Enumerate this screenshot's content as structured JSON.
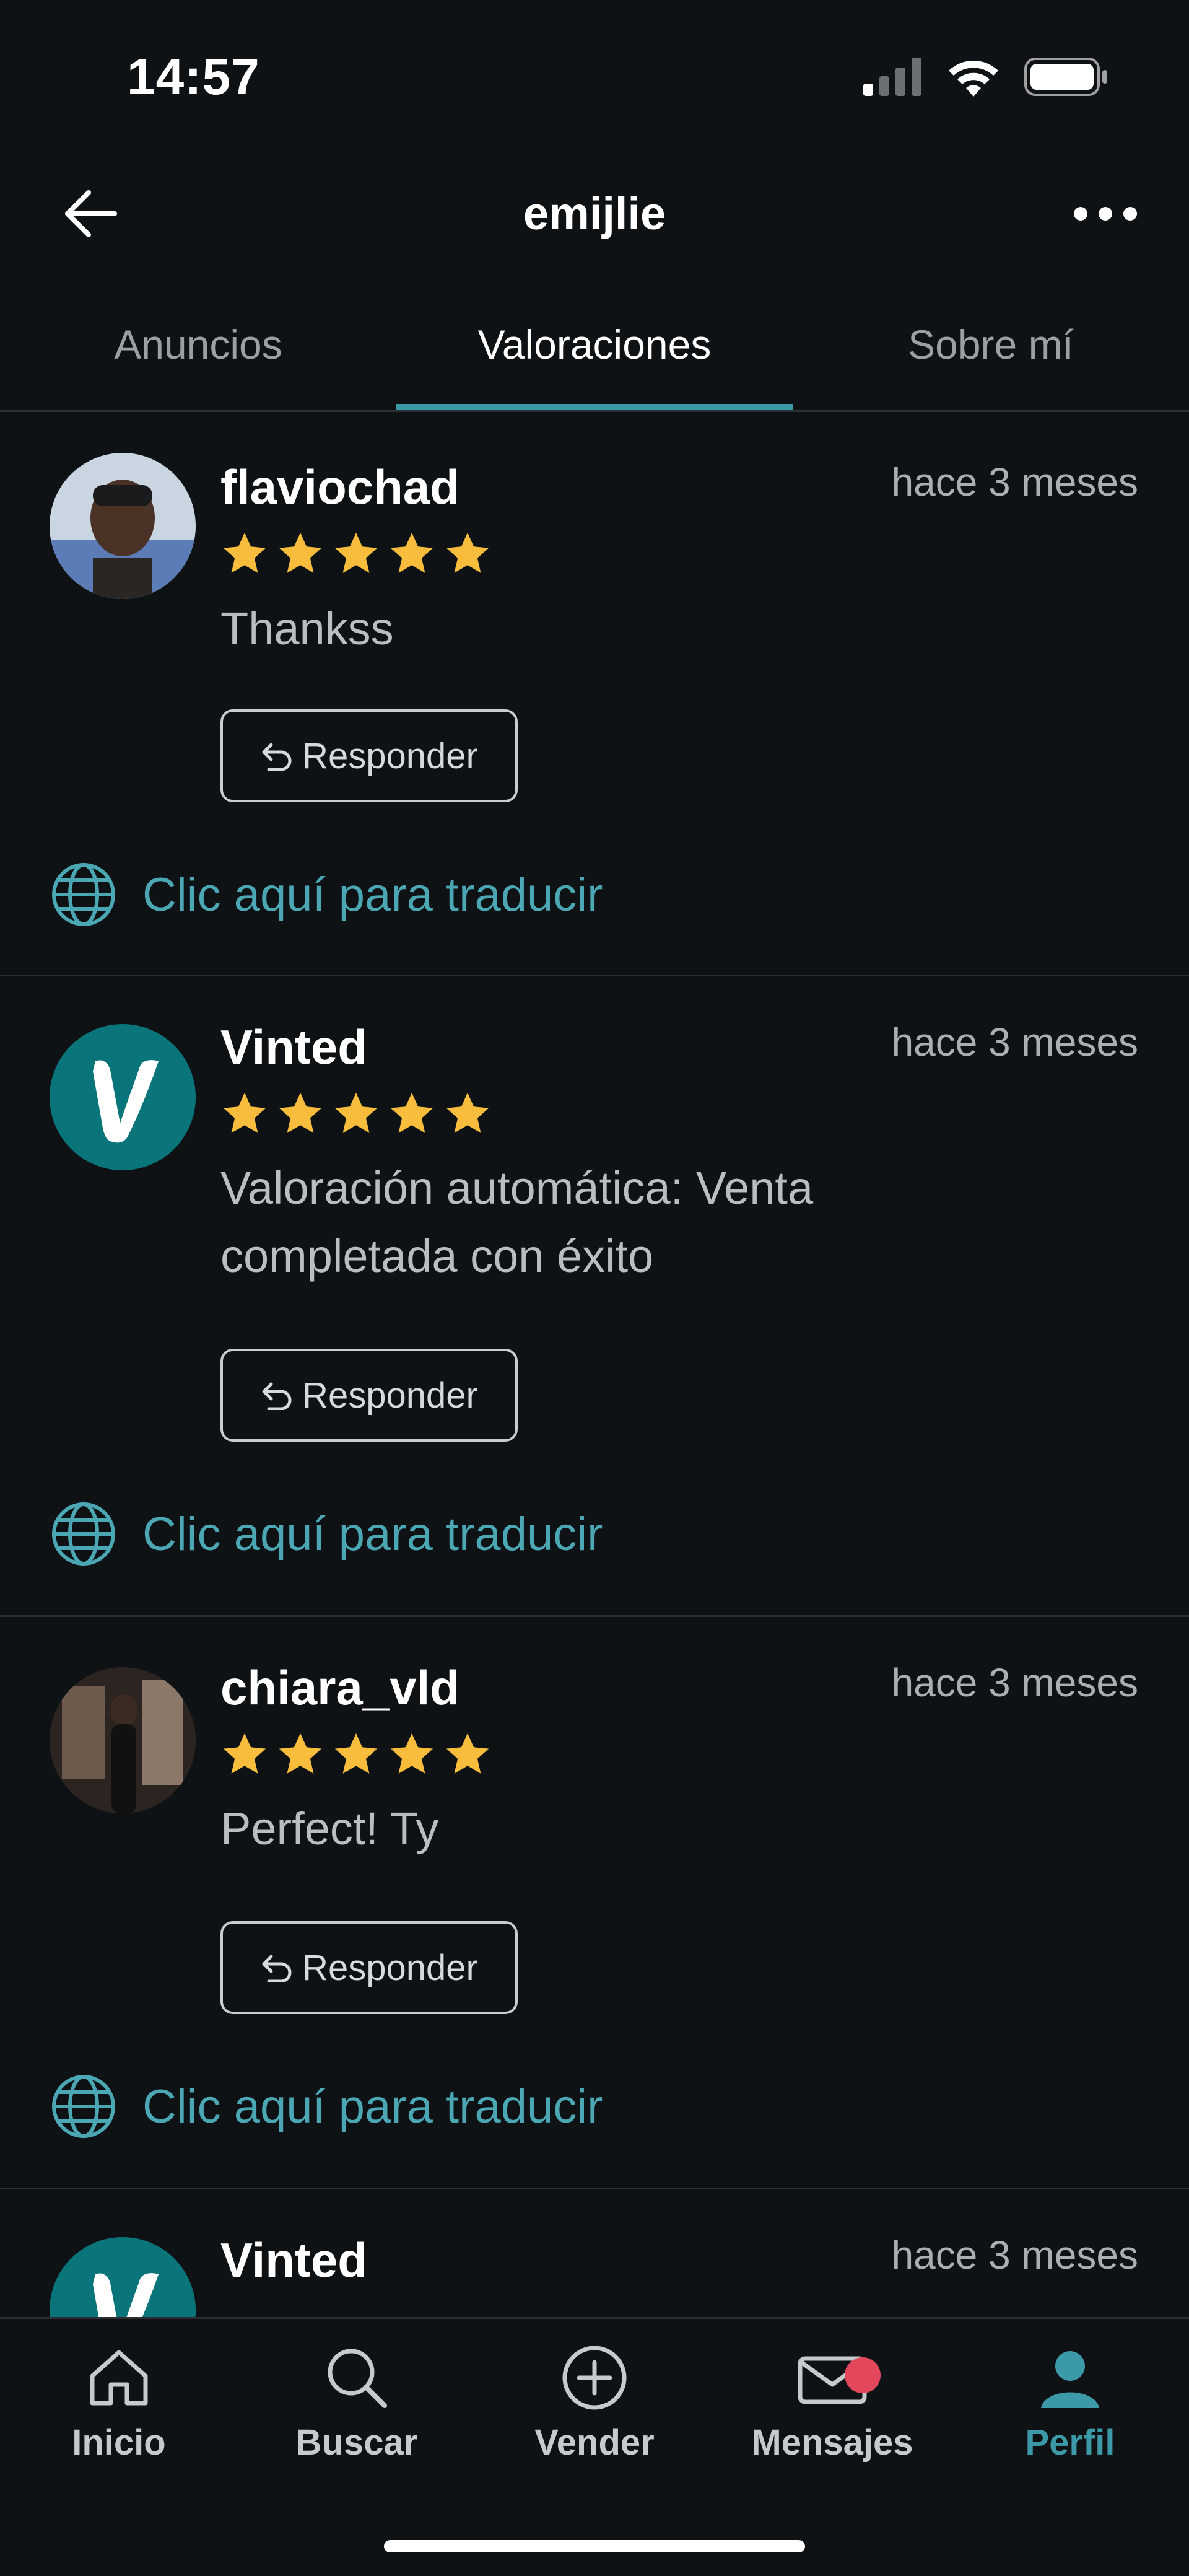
{
  "status_bar": {
    "time": "14:57"
  },
  "header": {
    "title": "emijlie"
  },
  "tabs": [
    {
      "label": "Anuncios",
      "active": false
    },
    {
      "label": "Valoraciones",
      "active": true
    },
    {
      "label": "Sobre mí",
      "active": false
    }
  ],
  "reviews": [
    {
      "username": "flaviochad",
      "date": "hace 3 meses",
      "rating": 5,
      "comment": "Thankss",
      "reply_label": "Responder",
      "translate_label": "Clic aquí para traducir"
    },
    {
      "username": "Vinted",
      "date": "hace 3 meses",
      "rating": 5,
      "comment": "Valoración automática: Venta completada con éxito",
      "reply_label": "Responder",
      "translate_label": "Clic aquí para traducir"
    },
    {
      "username": "chiara_vld",
      "date": "hace 3 meses",
      "rating": 5,
      "comment": "Perfect! Ty",
      "reply_label": "Responder",
      "translate_label": "Clic aquí para traducir"
    },
    {
      "username": "Vinted",
      "date": "hace 3 meses"
    }
  ],
  "bottom_nav": [
    {
      "label": "Inicio",
      "icon": "home-icon"
    },
    {
      "label": "Buscar",
      "icon": "search-icon"
    },
    {
      "label": "Vender",
      "icon": "plus-circle-icon"
    },
    {
      "label": "Mensajes",
      "icon": "mail-icon"
    },
    {
      "label": "Perfil",
      "icon": "profile-icon",
      "active": true
    }
  ],
  "colors": {
    "background": "#0f1214",
    "accent": "#3c9aa8",
    "star": "#f8bd3c",
    "vinted_brand": "#09757a",
    "badge": "#e3475c"
  }
}
